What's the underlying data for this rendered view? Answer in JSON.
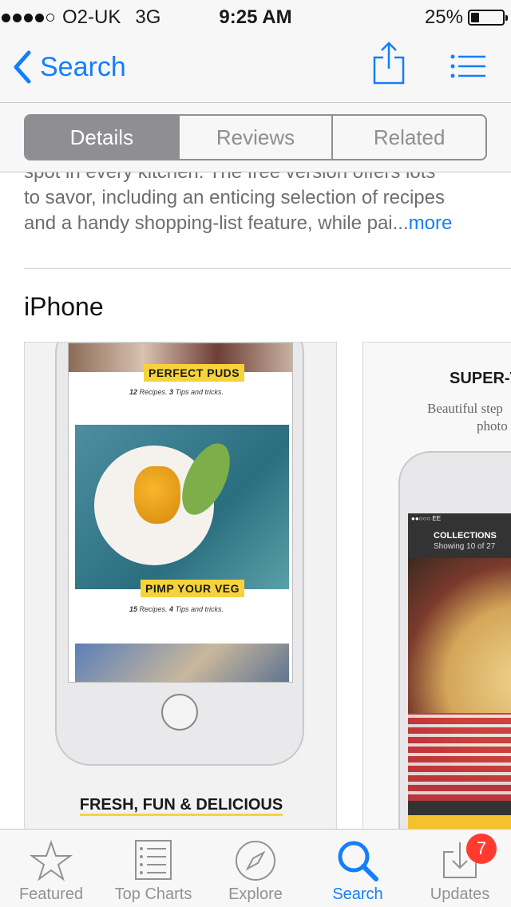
{
  "status": {
    "carrier": "O2-UK",
    "network": "3G",
    "time": "9:25 AM",
    "battery": "25%",
    "battery_level": 0.25,
    "signal_bars": 4
  },
  "nav": {
    "back_label": "Search"
  },
  "segments": [
    {
      "label": "Details",
      "active": true
    },
    {
      "label": "Reviews",
      "active": false
    },
    {
      "label": "Related",
      "active": false
    }
  ],
  "description": {
    "line_partial": "spot in every kitchen. The free version offers lots",
    "line1": "to savor, including an enticing selection of recipes",
    "line2": "and a handy shopping-list feature, while pai",
    "ellipsis": "...",
    "more": "more"
  },
  "section_title": "iPhone",
  "screenshot1": {
    "tag1": "PERFECT PUDS",
    "tag1_caption_num": "12",
    "tag1_caption_a": " Recipes. ",
    "tag1_caption_num2": "3",
    "tag1_caption_b": " Tips and tricks.",
    "tag2": "PIMP YOUR VEG",
    "tag2_caption_num": "15",
    "tag2_caption_a": " Recipes. ",
    "tag2_caption_num2": "4",
    "tag2_caption_b": " Tips and tricks.",
    "footer_title": "FRESH, FUN & DELICIOUS"
  },
  "screenshot2": {
    "title": "SUPER-TA",
    "sub1": "Beautiful step",
    "sub2": "photo",
    "mini_status": "●●○○○ EE",
    "collections": "COLLECTIONS",
    "showing": "Showing 10 of 27"
  },
  "tabs": [
    {
      "label": "Featured",
      "icon": "star-icon",
      "active": false
    },
    {
      "label": "Top Charts",
      "icon": "list-icon",
      "active": false
    },
    {
      "label": "Explore",
      "icon": "compass-icon",
      "active": false
    },
    {
      "label": "Search",
      "icon": "search-icon",
      "active": true
    },
    {
      "label": "Updates",
      "icon": "download-icon",
      "active": false
    }
  ],
  "updates_badge": "7",
  "colors": {
    "accent": "#157efb",
    "segment": "#8e8e93",
    "badge": "#ff3b30",
    "tag": "#f7d33b"
  }
}
